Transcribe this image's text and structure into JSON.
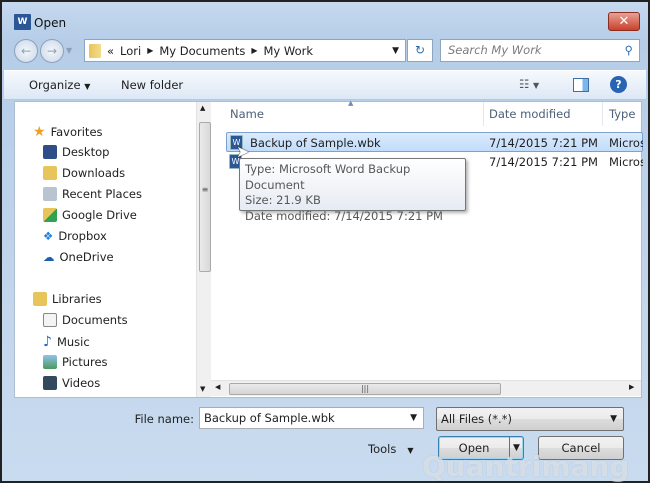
{
  "window": {
    "title": "Open",
    "app_icon": "W"
  },
  "address": {
    "overflow": "«",
    "crumbs": [
      "Lori",
      "My Documents",
      "My Work"
    ]
  },
  "search": {
    "placeholder": "Search My Work"
  },
  "toolbar": {
    "organize": "Organize",
    "new_folder": "New folder"
  },
  "nav": {
    "favorites": {
      "label": "Favorites",
      "items": [
        "Desktop",
        "Downloads",
        "Recent Places",
        "Google Drive",
        "Dropbox",
        "OneDrive"
      ]
    },
    "libraries": {
      "label": "Libraries",
      "items": [
        "Documents",
        "Music",
        "Pictures",
        "Videos"
      ]
    }
  },
  "columns": {
    "name": "Name",
    "date": "Date modified",
    "type": "Type"
  },
  "files": [
    {
      "name": "Backup of Sample.wbk",
      "date": "7/14/2015 7:21 PM",
      "type": "Micros"
    },
    {
      "name": "",
      "date": "7/14/2015 7:21 PM",
      "type": "Micros"
    }
  ],
  "tooltip": {
    "type": "Type: Microsoft Word Backup Document",
    "size": "Size: 21.9 KB",
    "modified": "Date modified: 7/14/2015 7:21 PM"
  },
  "bottom": {
    "file_name_label": "File name:",
    "file_name_value": "Backup of Sample.wbk",
    "filter": "All Files (*.*)",
    "tools": "Tools",
    "open": "Open",
    "cancel": "Cancel"
  },
  "watermark": "Quantrimang"
}
